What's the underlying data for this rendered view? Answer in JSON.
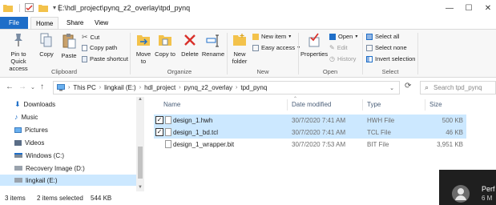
{
  "window": {
    "path_title": "E:\\hdl_project\\pynq_z2_overlay\\tpd_pynq",
    "minimize": "—",
    "maximize": "☐",
    "close": "✕"
  },
  "tabs": [
    "File",
    "Home",
    "Share",
    "View"
  ],
  "ribbon": {
    "clipboard": {
      "pin": "Pin to Quick access",
      "copy": "Copy",
      "paste": "Paste",
      "cut": "Cut",
      "copy_path": "Copy path",
      "paste_shortcut": "Paste shortcut",
      "label": "Clipboard"
    },
    "organize": {
      "move_to": "Move to",
      "copy_to": "Copy to",
      "delete": "Delete",
      "rename": "Rename",
      "label": "Organize"
    },
    "new": {
      "new_folder": "New folder",
      "new_item": "New item",
      "easy_access": "Easy access",
      "label": "New"
    },
    "open": {
      "properties": "Properties",
      "open": "Open",
      "edit": "Edit",
      "history": "History",
      "label": "Open"
    },
    "select": {
      "select_all": "Select all",
      "select_none": "Select none",
      "invert": "Invert selection",
      "label": "Select"
    }
  },
  "address": {
    "segments": [
      "This PC",
      "lingkail (E:)",
      "hdl_project",
      "pynq_z2_overlay",
      "tpd_pynq"
    ],
    "search_placeholder": "Search tpd_pynq"
  },
  "nav": {
    "items": [
      "Downloads",
      "Music",
      "Pictures",
      "Videos",
      "Windows (C:)",
      "Recovery Image (D:)",
      "lingkail (E:)"
    ],
    "selected_index": 6
  },
  "files": {
    "headers": [
      "Name",
      "Date modified",
      "Type",
      "Size"
    ],
    "rows": [
      {
        "name": "design_1.hwh",
        "date": "30/7/2020 7:41 AM",
        "type": "HWH File",
        "size": "500 KB",
        "selected": true
      },
      {
        "name": "design_1_bd.tcl",
        "date": "30/7/2020 7:41 AM",
        "type": "TCL File",
        "size": "46 KB",
        "selected": true
      },
      {
        "name": "design_1_wrapper.bit",
        "date": "30/7/2020 7:53 AM",
        "type": "BIT File",
        "size": "3,951 KB",
        "selected": false
      }
    ]
  },
  "status": {
    "items": "3 items",
    "selected": "2 items selected",
    "size": "544 KB"
  },
  "toast": {
    "title": "Perf",
    "subtitle": "6 M"
  },
  "colors": {
    "accent": "#1e6ec8",
    "selection": "#cce8ff",
    "folder": "#f3c24b"
  }
}
